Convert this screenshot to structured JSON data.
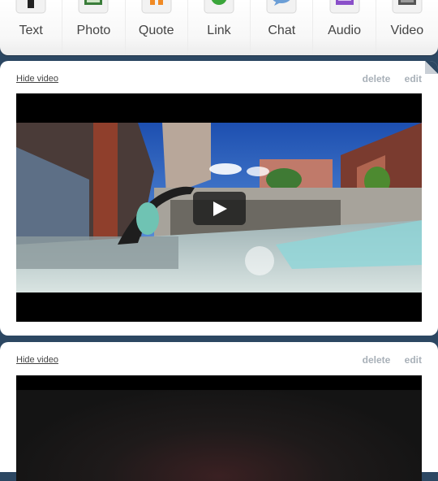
{
  "post_types": [
    {
      "label": "Text",
      "icon": "text-icon",
      "color": "#222222"
    },
    {
      "label": "Photo",
      "icon": "photo-icon",
      "color": "#3a7d3a"
    },
    {
      "label": "Quote",
      "icon": "quote-icon",
      "color": "#f08a24"
    },
    {
      "label": "Link",
      "icon": "link-icon",
      "color": "#3aa53a"
    },
    {
      "label": "Chat",
      "icon": "chat-icon",
      "color": "#6b9ed6"
    },
    {
      "label": "Audio",
      "icon": "audio-icon",
      "color": "#8a4fc9"
    },
    {
      "label": "Video",
      "icon": "video-icon",
      "color": "#555555"
    }
  ],
  "posts": [
    {
      "hide_label": "Hide video",
      "delete_label": "delete",
      "edit_label": "edit"
    },
    {
      "hide_label": "Hide video",
      "delete_label": "delete",
      "edit_label": "edit"
    }
  ]
}
